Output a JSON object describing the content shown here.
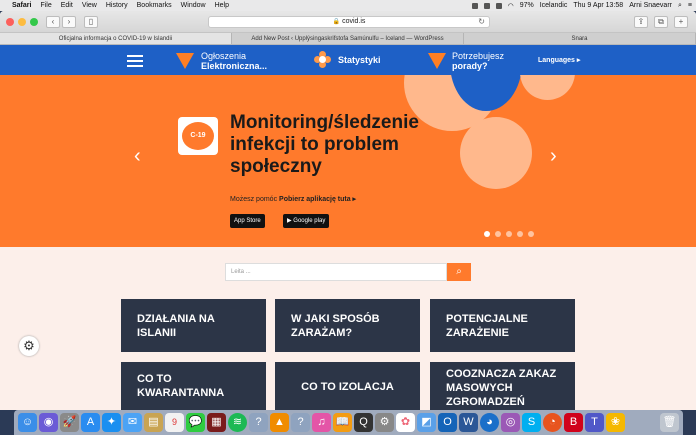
{
  "menubar": {
    "app": "Safari",
    "items": [
      "File",
      "Edit",
      "View",
      "History",
      "Bookmarks",
      "Window",
      "Help"
    ],
    "battery": "97%",
    "input_source": "Icelandic",
    "datetime": "Thu 9 Apr 13:58",
    "user": "Arni Snaevarr"
  },
  "browser": {
    "url": "covid.is",
    "tabs": [
      "Oficjalna informacja o COVID-19 w Islandii",
      "Add New Post ‹ Upplýsingaskrifstofa Samúnulfu – Iceland — WordPress",
      "Snara"
    ]
  },
  "nav": {
    "item1_line1": "Ogłoszenia",
    "item1_line2": "Elektroniczna...",
    "item2": "Statystyki",
    "item3_line1": "Potrzebujesz",
    "item3_line2": "porady?",
    "languages": "Languages ▸"
  },
  "hero": {
    "badge": "C-19",
    "title": "Monitoring/śledzenie infekcji to problem społeczny",
    "help_prefix": "Możesz pomóc",
    "help_link": "Pobierz aplikację tuta ▸",
    "app_store": "App Store",
    "google_play": "Google play",
    "colors": {
      "orange": "#ff7a2c",
      "peach": "#ffb88c",
      "blue": "#1e60c6"
    }
  },
  "search": {
    "placeholder": "Leita ..."
  },
  "cards": [
    "DZIAŁANIA NA ISLANII",
    "W JAKI SPOSÓB ZARAŻAM?",
    "POTENCJALNE ZARAŻENIE",
    "CO TO KWARANTANNA",
    "CO TO IZOLACJA",
    "COOZNACZA ZAKAZ MASOWYCH ZGROMADZEŃ"
  ],
  "dock": {
    "icons": [
      "finder-icon",
      "siri-icon",
      "launchpad-icon",
      "appstore-icon",
      "safari-icon",
      "mail-icon",
      "notes-icon",
      "calendar-icon",
      "messages-icon",
      "photobooth-icon",
      "spotify-icon",
      "help-icon",
      "vlc-icon",
      "help-icon",
      "itunes-icon",
      "books-icon",
      "quicktime-icon",
      "settings-icon",
      "photos-icon",
      "preview-icon",
      "outlook-icon",
      "word-icon",
      "firefox-icon",
      "podcasts-icon",
      "skype-icon",
      "firefox-icon",
      "bitdefender-icon",
      "teams-icon",
      "sunflower-icon",
      "trash-icon"
    ],
    "calendar_day": "9"
  }
}
